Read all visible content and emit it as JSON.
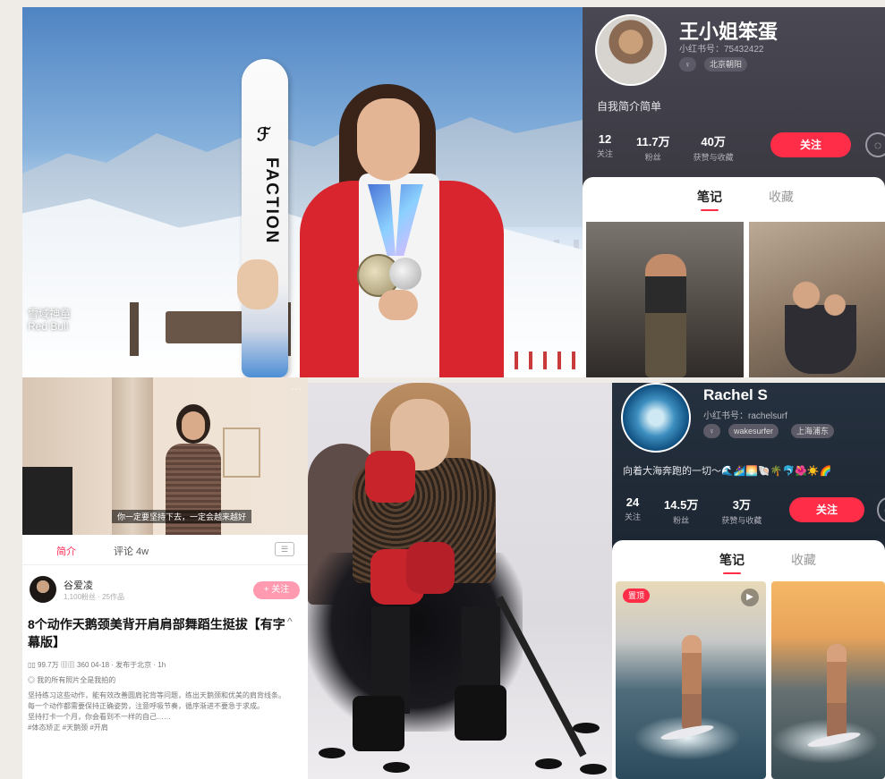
{
  "ski_photo": {
    "ski_brand": "FACTION",
    "ski_logo": "ℱ",
    "watermark_line1": "雪域神童",
    "watermark_line2": "Red Bull"
  },
  "profile1": {
    "name": "王小姐笨蛋",
    "id_text": "小红书号：75432422",
    "tag_1": "♀",
    "tag_2": "北京朝阳",
    "bio": "自我简介简单",
    "stats": [
      {
        "value": "12",
        "label": "关注"
      },
      {
        "value": "11.7万",
        "label": "粉丝"
      },
      {
        "value": "40万",
        "label": "获赞与收藏"
      }
    ],
    "follow_label": "关注",
    "chat_label": "◌",
    "tabs": [
      {
        "label": "笔记"
      },
      {
        "label": "收藏"
      }
    ]
  },
  "video_note": {
    "subtitle": "你一定要坚持下去，一定会越来越好",
    "menu": "⋯",
    "tabs": [
      {
        "label": "简介"
      },
      {
        "label": "评论 4w"
      }
    ],
    "tab_icon": "☰",
    "author_name": "谷爱凌",
    "author_meta": "1,100粉丝 · 25作品",
    "follow_label": "+ 关注",
    "title": "8个动作天鹅颈美背开肩肩部舞蹈生挺拔【有字幕版】",
    "caret": "^",
    "statline": "▯▯ 99.7万  ▥▥ 360  04-18 · 发布于北京 · 1h",
    "line2": "◎ 我的所有照片全是我拍的",
    "body_lines": [
      "坚持练习这些动作，能有效改善圆肩驼背等问题，练出天鹅颈和优美的肩背线条。",
      "每一个动作都需要保持正确姿势，注意呼吸节奏，循序渐进不要急于求成。",
      "坚持打卡一个月，你会看到不一样的自己……",
      "#体态矫正  #天鹅颈  #开肩"
    ]
  },
  "profile2": {
    "name": "Rachel S",
    "id_text": "小红书号：rachelsurf",
    "tag_1": "♀",
    "tag_2": "wakesurfer",
    "tag_3": "上海浦东",
    "bio": "向着大海奔跑的一切～🌊🏄‍♀️🌅🐚🌴🐬🌺☀️🌈",
    "stats": [
      {
        "value": "24",
        "label": "关注"
      },
      {
        "value": "14.5万",
        "label": "粉丝"
      },
      {
        "value": "3万",
        "label": "获赞与收藏"
      }
    ],
    "follow_label": "关注",
    "chat_label": "◌",
    "tabs": [
      {
        "label": "笔记"
      },
      {
        "label": "收藏"
      }
    ],
    "thumb_badge": "置顶",
    "play_icon": "▶"
  }
}
